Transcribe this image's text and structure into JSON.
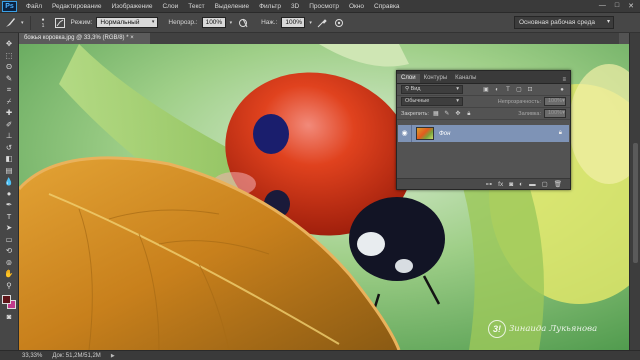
{
  "app": {
    "logo": "Ps"
  },
  "menu": [
    "Файл",
    "Редактирование",
    "Изображение",
    "Слои",
    "Текст",
    "Выделение",
    "Фильтр",
    "3D",
    "Просмотр",
    "Окно",
    "Справка"
  ],
  "window_controls": [
    "—",
    "□",
    "✕"
  ],
  "options": {
    "size_value": "1",
    "mode_label": "Режим:",
    "mode_value": "Нормальный",
    "opacity_label": "Непрозр.:",
    "opacity_value": "100%",
    "flow_label": "Наж.:",
    "flow_value": "100%"
  },
  "workspace": "Основная рабочая среда",
  "document_tab": "божья коровка.jpg @ 33,3% (RGB/8) *",
  "status": {
    "zoom": "33,33%",
    "doc": "Док: 51,2M/51,2M"
  },
  "layers_panel": {
    "tabs": [
      "Слои",
      "Контуры",
      "Каналы"
    ],
    "filter_value": "Вид",
    "blend_mode": "Обычные",
    "opacity_label": "Непрозрачность:",
    "opacity_value": "100%",
    "lock_label": "Закрепить:",
    "fill_label": "Заливка:",
    "fill_value": "100%",
    "layer_name": "Фон"
  },
  "watermark": {
    "logo": "3!",
    "text": "Зинаида Лукьянова"
  },
  "colors": {
    "foreground": "#5e1418",
    "background": "#c03a8b",
    "selected_layer": "#7e93b6"
  }
}
